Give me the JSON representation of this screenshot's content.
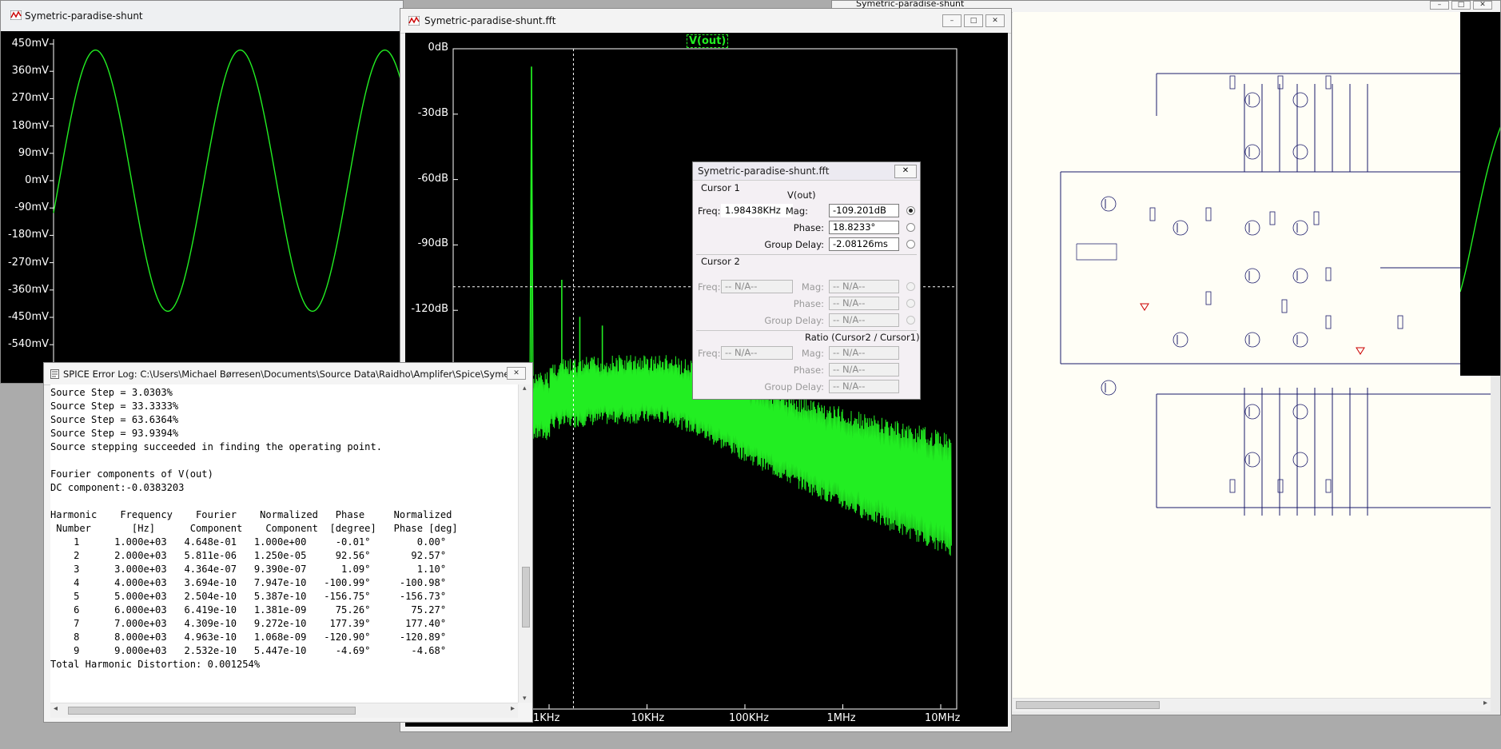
{
  "waveform_window": {
    "title": "Symetric-paradise-shunt",
    "y_ticks": [
      "450mV",
      "360mV",
      "270mV",
      "180mV",
      "90mV",
      "0mV",
      "-90mV",
      "-180mV",
      "-270mV",
      "-360mV",
      "-450mV",
      "-540mV"
    ]
  },
  "fft_window": {
    "title": "Symetric-paradise-shunt.fft",
    "trace_label": "V(out)",
    "y_ticks": [
      "0dB",
      "-30dB",
      "-60dB",
      "-90dB",
      "-120dB"
    ],
    "x_ticks": [
      "1KHz",
      "10KHz",
      "100KHz",
      "1MHz",
      "10MHz"
    ]
  },
  "schematic_window": {
    "title": "Symetric-paradise-shunt"
  },
  "cursor_dialog": {
    "title": "Symetric-paradise-shunt.fft",
    "cursor1": {
      "header": "Cursor 1",
      "trace": "V(out)",
      "freq_label": "Freq:",
      "freq": "1.98438KHz",
      "mag_label": "Mag:",
      "mag": "-109.201dB",
      "phase_label": "Phase:",
      "phase": "18.8233°",
      "gd_label": "Group Delay:",
      "gd": "-2.08126ms"
    },
    "cursor2": {
      "header": "Cursor 2",
      "freq_label": "Freq:",
      "freq": "-- N/A--",
      "mag_label": "Mag:",
      "mag": "-- N/A--",
      "phase_label": "Phase:",
      "phase": "-- N/A--",
      "gd_label": "Group Delay:",
      "gd": "-- N/A--"
    },
    "ratio": {
      "header": "Ratio (Cursor2 / Cursor1)",
      "freq_label": "Freq:",
      "freq": "-- N/A--",
      "mag_label": "Mag:",
      "mag": "-- N/A--",
      "phase_label": "Phase:",
      "phase": "-- N/A--",
      "gd_label": "Group Delay:",
      "gd": "-- N/A--"
    }
  },
  "error_log": {
    "title": "SPICE Error Log: C:\\Users\\Michael Børresen\\Documents\\Source Data\\Raidho\\Amplifer\\Spice\\Symetr...",
    "lines": [
      "Source Step = 3.0303%",
      "Source Step = 33.3333%",
      "Source Step = 63.6364%",
      "Source Step = 93.9394%",
      "Source stepping succeeded in finding the operating point.",
      "",
      "Fourier components of V(out)",
      "DC component:-0.0383203",
      "",
      "Harmonic    Frequency    Fourier    Normalized   Phase     Normalized",
      " Number       [Hz]      Component    Component  [degree]   Phase [deg]",
      "    1      1.000e+03   4.648e-01   1.000e+00     -0.01°        0.00°",
      "    2      2.000e+03   5.811e-06   1.250e-05     92.56°       92.57°",
      "    3      3.000e+03   4.364e-07   9.390e-07      1.09°        1.10°",
      "    4      4.000e+03   3.694e-10   7.947e-10   -100.99°     -100.98°",
      "    5      5.000e+03   2.504e-10   5.387e-10   -156.75°     -156.73°",
      "    6      6.000e+03   6.419e-10   1.381e-09     75.26°       75.27°",
      "    7      7.000e+03   4.309e-10   9.272e-10    177.39°      177.40°",
      "    8      8.000e+03   4.963e-10   1.068e-09   -120.90°     -120.89°",
      "    9      9.000e+03   2.532e-10   5.447e-10     -4.69°       -4.68°",
      "Total Harmonic Distortion: 0.001254%"
    ]
  },
  "colors": {
    "trace": "#22ee22",
    "plot_bg": "#000000",
    "axis": "#ffffff"
  }
}
